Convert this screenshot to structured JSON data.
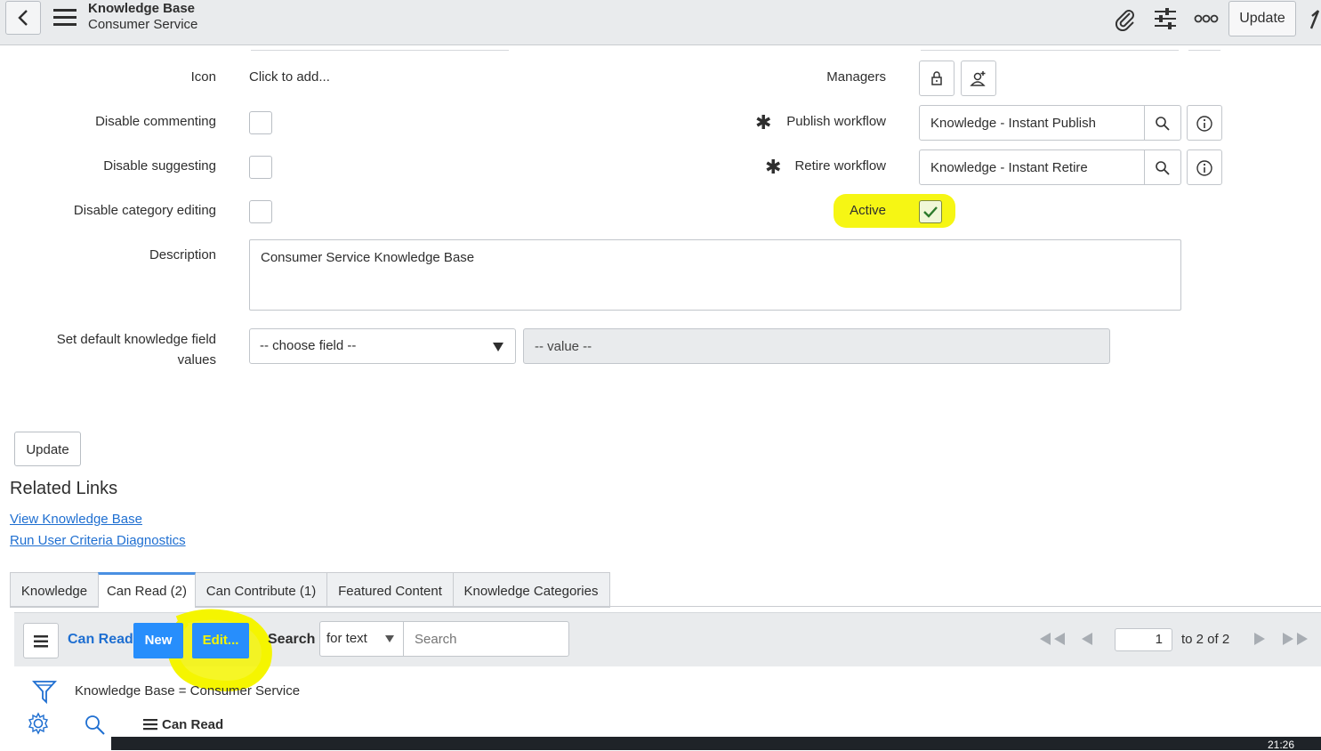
{
  "header": {
    "title": "Knowledge Base",
    "subtitle": "Consumer Service",
    "update_label": "Update"
  },
  "form": {
    "icon": {
      "label": "Icon",
      "value": "Click to add..."
    },
    "disable_commenting": {
      "label": "Disable commenting"
    },
    "disable_suggesting": {
      "label": "Disable suggesting"
    },
    "disable_category_editing": {
      "label": "Disable category editing"
    },
    "description": {
      "label": "Description",
      "value": "Consumer Service Knowledge Base"
    },
    "default_field": {
      "label_line1": "Set default knowledge field",
      "label_line2": "values",
      "choose_field": "-- choose field --",
      "value_placeholder": "-- value --"
    },
    "managers": {
      "label": "Managers"
    },
    "publish_workflow": {
      "label": "Publish workflow",
      "value": "Knowledge - Instant Publish"
    },
    "retire_workflow": {
      "label": "Retire workflow",
      "value": "Knowledge - Instant Retire"
    },
    "active": {
      "label": "Active",
      "checked": true
    }
  },
  "actions": {
    "update_label": "Update"
  },
  "related_links": {
    "title": "Related Links",
    "links": [
      "View Knowledge Base",
      "Run User Criteria Diagnostics"
    ]
  },
  "tabs": [
    {
      "label": "Knowledge"
    },
    {
      "label": "Can Read (2)"
    },
    {
      "label": "Can Contribute (1)"
    },
    {
      "label": "Featured Content"
    },
    {
      "label": "Knowledge Categories"
    }
  ],
  "list": {
    "title": "Can Read",
    "new_label": "New",
    "edit_label": "Edit...",
    "search_label": "Search",
    "search_mode": "for text",
    "search_placeholder": "Search",
    "page_value": "1",
    "page_info": "to 2 of 2",
    "filter_text": "Knowledge Base = Consumer Service",
    "column_header": "Can Read"
  },
  "taskbar": {
    "clock": "21:26"
  },
  "colors": {
    "accent": "#278efc",
    "highlight": "#f5f500",
    "link": "#1f6fd1"
  }
}
